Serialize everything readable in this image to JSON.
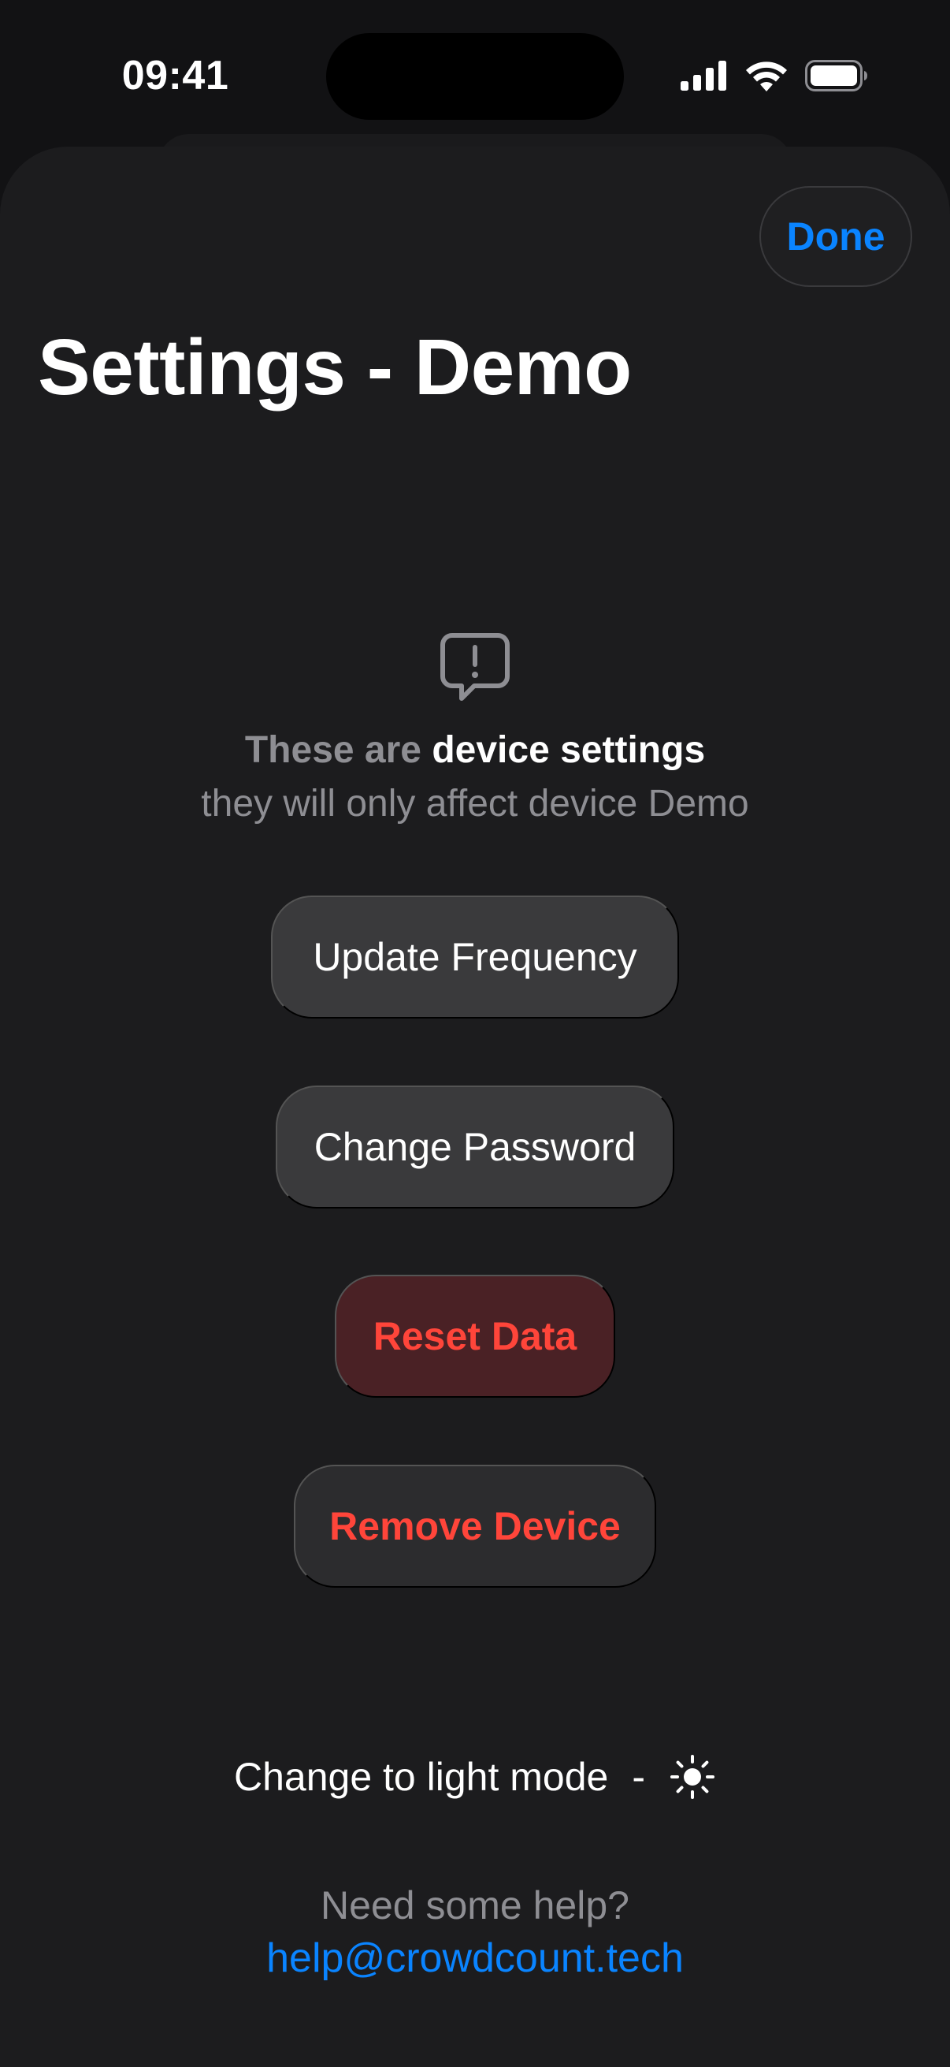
{
  "status_bar": {
    "time": "09:41",
    "icons": [
      "cellular-signal-icon",
      "wifi-icon",
      "battery-icon"
    ]
  },
  "sheet": {
    "done_label": "Done",
    "title": "Settings - Demo",
    "notice": {
      "icon": "exclamation-bubble-icon",
      "prefix": "These are ",
      "emphasis": "device settings",
      "line2": "they will only affect device Demo"
    },
    "actions": [
      {
        "label": "Update Frequency"
      },
      {
        "label": "Change Password"
      },
      {
        "label": "Reset Data"
      },
      {
        "label": "Remove Device"
      }
    ],
    "light_mode": {
      "label": "Change to light mode",
      "separator": "-",
      "icon": "sun-icon"
    },
    "help": {
      "prompt": "Need some help?",
      "email": "help@crowdcount.tech"
    }
  },
  "colors": {
    "accent": "#0a84ff",
    "destructive": "#ff453a",
    "background": "#1c1c1e",
    "button": "#3a3a3c"
  }
}
